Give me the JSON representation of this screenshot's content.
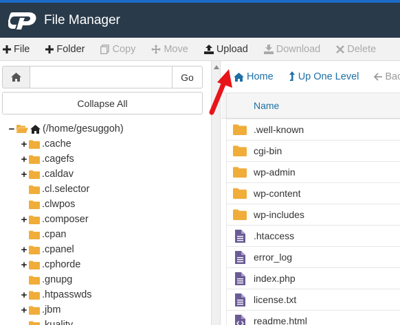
{
  "app": {
    "title": "File Manager",
    "logo_text": "cP"
  },
  "toolbar": {
    "items": [
      {
        "label": "File",
        "icon": "plus-icon",
        "enabled": true
      },
      {
        "label": "Folder",
        "icon": "plus-icon",
        "enabled": true
      },
      {
        "label": "Copy",
        "icon": "copy-icon",
        "enabled": false
      },
      {
        "label": "Move",
        "icon": "move-icon",
        "enabled": false
      },
      {
        "label": "Upload",
        "icon": "upload-icon",
        "enabled": true
      },
      {
        "label": "Download",
        "icon": "download-icon",
        "enabled": false
      },
      {
        "label": "Delete",
        "icon": "close-icon",
        "enabled": false
      }
    ]
  },
  "sidebar": {
    "path_value": "",
    "go_label": "Go",
    "collapse_label": "Collapse All",
    "tree": [
      {
        "label": "(/home/gesuggoh)",
        "expander": "−",
        "type": "home"
      },
      {
        "label": ".cache",
        "expander": "+"
      },
      {
        "label": ".cagefs",
        "expander": "+"
      },
      {
        "label": ".caldav",
        "expander": "+"
      },
      {
        "label": ".cl.selector",
        "expander": ""
      },
      {
        "label": ".clwpos",
        "expander": ""
      },
      {
        "label": ".composer",
        "expander": "+"
      },
      {
        "label": ".cpan",
        "expander": ""
      },
      {
        "label": ".cpanel",
        "expander": "+"
      },
      {
        "label": ".cphorde",
        "expander": "+"
      },
      {
        "label": ".gnupg",
        "expander": ""
      },
      {
        "label": ".htpasswds",
        "expander": "+"
      },
      {
        "label": ".jbm",
        "expander": "+"
      },
      {
        "label": ".kuality",
        "expander": ""
      }
    ]
  },
  "nav": {
    "home_label": "Home",
    "up_label": "Up One Level",
    "back_label": "Back"
  },
  "table": {
    "column_name": "Name",
    "rows": [
      {
        "name": ".well-known",
        "type": "folder"
      },
      {
        "name": "cgi-bin",
        "type": "folder"
      },
      {
        "name": "wp-admin",
        "type": "folder"
      },
      {
        "name": "wp-content",
        "type": "folder"
      },
      {
        "name": "wp-includes",
        "type": "folder"
      },
      {
        "name": ".htaccess",
        "type": "file"
      },
      {
        "name": "error_log",
        "type": "file"
      },
      {
        "name": "index.php",
        "type": "file"
      },
      {
        "name": "license.txt",
        "type": "file"
      },
      {
        "name": "readme.html",
        "type": "code"
      }
    ]
  },
  "colors": {
    "header_bg": "#293a4a",
    "accent_blue": "#1d6fa5",
    "folder": "#f0ad3a",
    "file_icon": "#6b5b95",
    "annotation_arrow": "#e8141b"
  }
}
